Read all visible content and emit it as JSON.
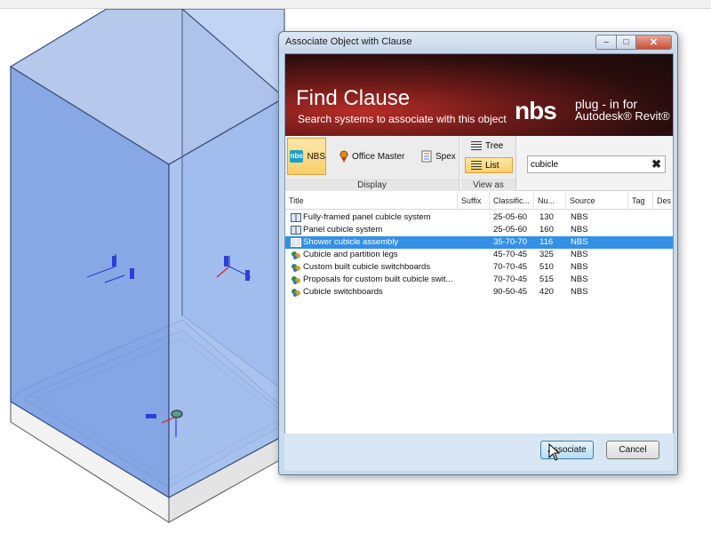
{
  "dialog": {
    "title": "Associate Object with Clause",
    "banner_title": "Find Clause",
    "banner_subtitle": "Search systems to associate with this object",
    "brand_logo": "nbs",
    "brand_line1": "plug - in for",
    "brand_line2": "Autodesk® Revit®"
  },
  "ribbon": {
    "display_group_label": "Display",
    "view_group_label": "View as",
    "sources": [
      {
        "label": "NBS",
        "icon": "nbs-icon",
        "active": true
      },
      {
        "label": "Office Master",
        "icon": "ribbon-medal-icon",
        "active": false
      },
      {
        "label": "Spex",
        "icon": "spex-icon",
        "active": false
      }
    ],
    "view_tree": "Tree",
    "view_list": "List",
    "active_view": "List"
  },
  "search": {
    "value": "cubicle",
    "clear_symbol": "✖"
  },
  "list": {
    "columns": [
      "Title",
      "Suffix",
      "Classific...",
      "Nu...",
      "Source",
      "Tag",
      "Des"
    ],
    "selected_index": 2,
    "rows": [
      {
        "title": "Fully-framed panel cubicle system",
        "suffix": "",
        "classification": "25-05-60",
        "number": "130",
        "source": "NBS",
        "icon": "book-icon"
      },
      {
        "title": "Panel cubicle system",
        "suffix": "",
        "classification": "25-05-60",
        "number": "160",
        "source": "NBS",
        "icon": "book-icon"
      },
      {
        "title": "Shower cubicle assembly",
        "suffix": "",
        "classification": "35-70-70",
        "number": "116",
        "source": "NBS",
        "icon": "book-icon"
      },
      {
        "title": "Cubicle and partition legs",
        "suffix": "",
        "classification": "45-70-45",
        "number": "325",
        "source": "NBS",
        "icon": "parts-icon"
      },
      {
        "title": "Custom built cubicle switchboards",
        "suffix": "",
        "classification": "70-70-45",
        "number": "510",
        "source": "NBS",
        "icon": "parts-icon"
      },
      {
        "title": "Proposals for custom built cubicle swit...",
        "suffix": "",
        "classification": "70-70-45",
        "number": "515",
        "source": "NBS",
        "icon": "parts-icon"
      },
      {
        "title": "Cubicle switchboards",
        "suffix": "",
        "classification": "90-50-45",
        "number": "420",
        "source": "NBS",
        "icon": "parts-icon"
      }
    ]
  },
  "footer": {
    "associate_label": "Associate",
    "cancel_label": "Cancel"
  },
  "colors": {
    "selection": "#3390e6",
    "cubicle_fill": "#8fb0e8",
    "banner_red": "#b82c26"
  }
}
